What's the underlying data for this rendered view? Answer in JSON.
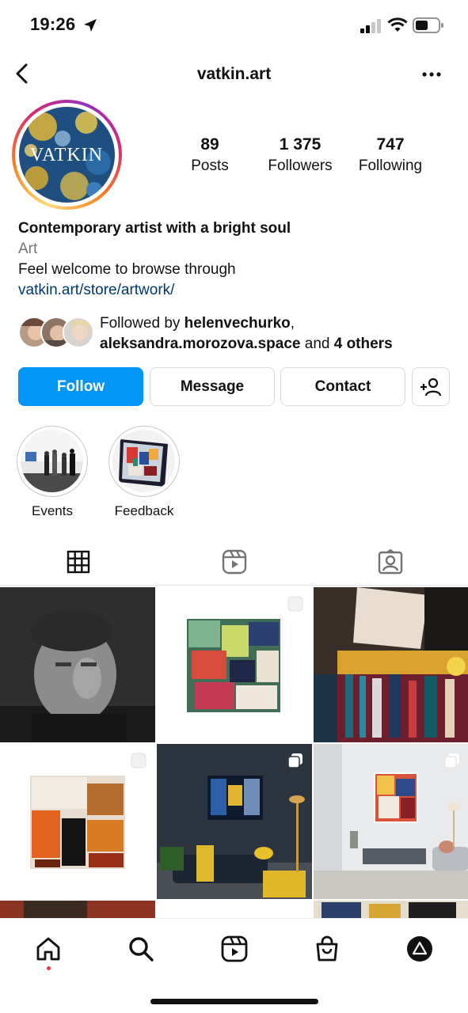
{
  "status_bar": {
    "time": "19:26",
    "icons": [
      "location-arrow-icon",
      "cellular-signal-icon",
      "wifi-icon",
      "battery-icon"
    ]
  },
  "header": {
    "username": "vatkin.art",
    "back_icon": "chevron-left-icon",
    "more_icon": "ellipsis-icon"
  },
  "profile": {
    "avatar_text": "VATKIN",
    "stats": [
      {
        "value": "89",
        "label": "Posts"
      },
      {
        "value": "1 375",
        "label": "Followers"
      },
      {
        "value": "747",
        "label": "Following"
      }
    ],
    "bio": {
      "name": "Contemporary artist with a bright soul",
      "category": "Art",
      "text": "Feel welcome to browse through",
      "link": "vatkin.art/store/artwork/"
    },
    "followed_by": {
      "prefix": "Followed by ",
      "user1": "helenvechurko",
      "sep": ",",
      "user2": "aleksandra.morozova.space",
      "mid": " and ",
      "others": "4 others"
    }
  },
  "actions": {
    "follow": "Follow",
    "message": "Message",
    "contact": "Contact",
    "add_user_icon": "person-add-icon"
  },
  "highlights": [
    {
      "label": "Events"
    },
    {
      "label": "Feedback"
    }
  ],
  "tabs": [
    {
      "icon": "grid-icon",
      "active": true
    },
    {
      "icon": "reels-icon",
      "active": false
    },
    {
      "icon": "tagged-icon",
      "active": false
    }
  ],
  "bottom_nav": [
    {
      "icon": "home-icon"
    },
    {
      "icon": "search-icon"
    },
    {
      "icon": "reels-icon"
    },
    {
      "icon": "shop-bag-icon"
    },
    {
      "icon": "profile-avatar-icon"
    }
  ],
  "colors": {
    "primary_blue": "#0095f6",
    "link_blue": "#00376b",
    "secondary_text": "#737373",
    "notification_dot": "#ff3040"
  }
}
